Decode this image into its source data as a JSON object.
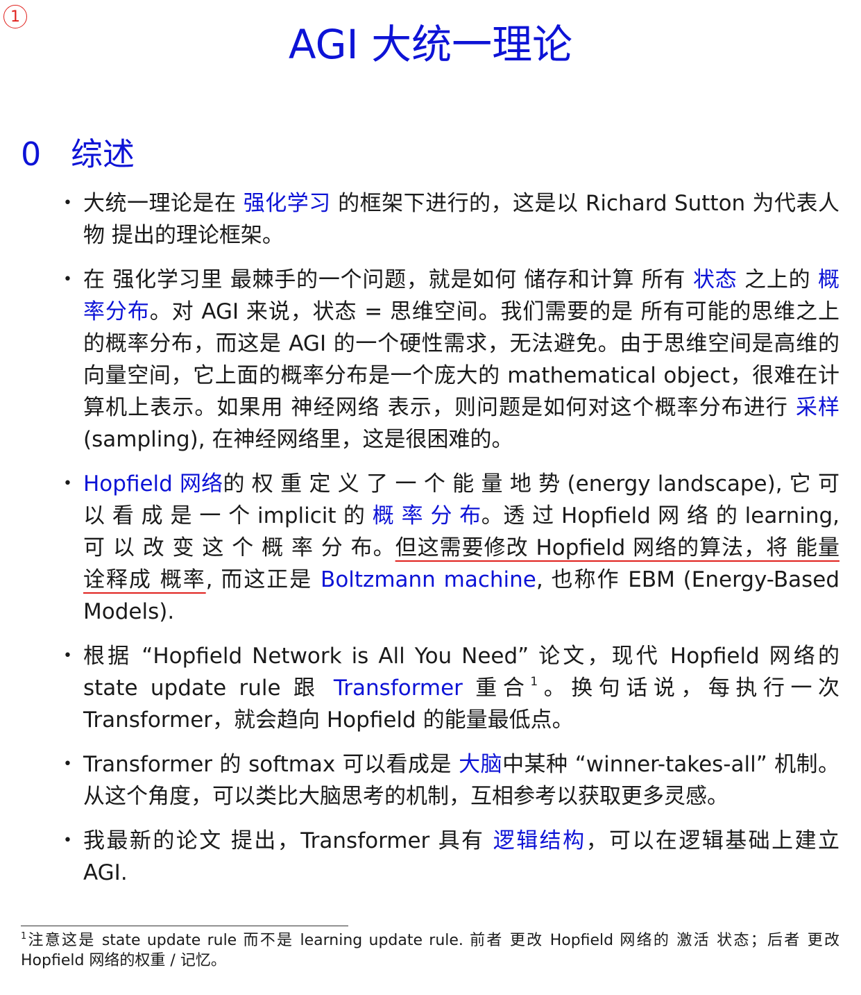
{
  "page_number": "1",
  "title": "AGI 大统一理论",
  "section": {
    "number": "0",
    "title": "综述"
  },
  "bullets": [
    {
      "parts": [
        "大统一理论是在 ",
        "强化学习",
        " 的框架下进行的，这是以 Richard Sutton 为代表人物 提出的理论框架。"
      ]
    },
    {
      "parts": [
        "在 强化学习里 最棘手的一个问题，就是如何 储存和计算 所有 ",
        "状态",
        " 之上的 ",
        "概率分布",
        "。对 AGI 来说，状态 = 思维空间。我们需要的是 所有可能的思维之上的概率分布，而这是 AGI 的一个硬性需求，无法避免。由于思维空间是高维的向量空间，它上面的概率分布是一个庞大的 mathematical object，很难在计算机上表示。如果用 神经网络 表示，则问题是如何对这个概率分布进行 ",
        "采样",
        " (sampling), 在神经网络里，这是很困难的。"
      ]
    },
    {
      "parts": [
        "Hopfield 网络",
        "的 权 重 定 义 了 一 个 能 量 地 势 (energy landscape), 它 可 以 看 成 是 一 个 implicit 的 ",
        "概 率 分 布",
        "。透 过 Hopfield 网 络 的 learning, 可 以 改 变 这 个 概 率 分 布。",
        "但这需要修改 Hopfield 网络的算法，将 能量 诠释成 概率",
        ", 而这正是 ",
        "Boltzmann machine",
        ", 也称作 EBM (Energy-Based Models)."
      ]
    },
    {
      "parts": [
        "根据 “Hopfield Network is All You Need” 论文，现代 Hopfield 网络的 state update rule 跟 ",
        "Transformer",
        " 重合",
        "1",
        "。换句话说，每执行一次 Transformer，就会趋向 Hopfield 的能量最低点。"
      ]
    },
    {
      "parts": [
        "Transformer 的 softmax 可以看成是 ",
        "大脑",
        "中某种 “winner-takes-all” 机制。从这个角度，可以类比大脑思考的机制，互相参考以获取更多灵感。"
      ]
    },
    {
      "parts": [
        "我最新的论文 提出，Transformer 具有 ",
        "逻辑结构",
        "，可以在逻辑基础上建立 AGI."
      ]
    }
  ],
  "footnote": {
    "mark": "1",
    "text": "注意这是 state update rule 而不是 learning update rule. 前者 更改 Hopfield 网络的 激活 状态；后者 更改 Hopfield 网络的权重 / 记忆。"
  },
  "colors": {
    "accent": "#0d13d6",
    "underline": "#e0201c",
    "page_circle": "#e0201c"
  }
}
